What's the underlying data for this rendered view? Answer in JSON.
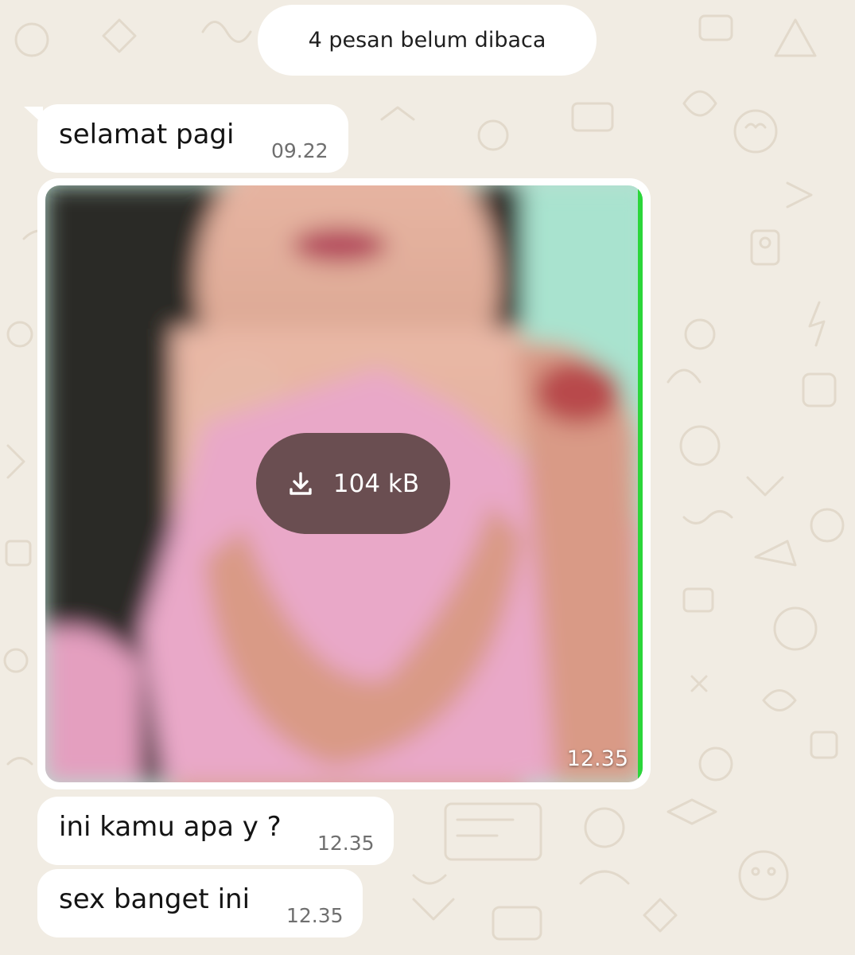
{
  "unread_banner": {
    "label": "4 pesan belum dibaca"
  },
  "messages": [
    {
      "type": "text",
      "text": "selamat pagi",
      "time": "09.22"
    },
    {
      "type": "image",
      "download": {
        "icon": "download-icon",
        "size": "104 kB"
      },
      "time": "12.35"
    },
    {
      "type": "text",
      "text": "ini kamu apa y ?",
      "time": "12.35"
    },
    {
      "type": "text",
      "text": "sex banget ini",
      "time": "12.35"
    }
  ],
  "colors": {
    "chat_background": "#f1ece3",
    "bubble": "#ffffff",
    "timestamp": "#6f6f6f",
    "download_overlay": "#46342f"
  }
}
